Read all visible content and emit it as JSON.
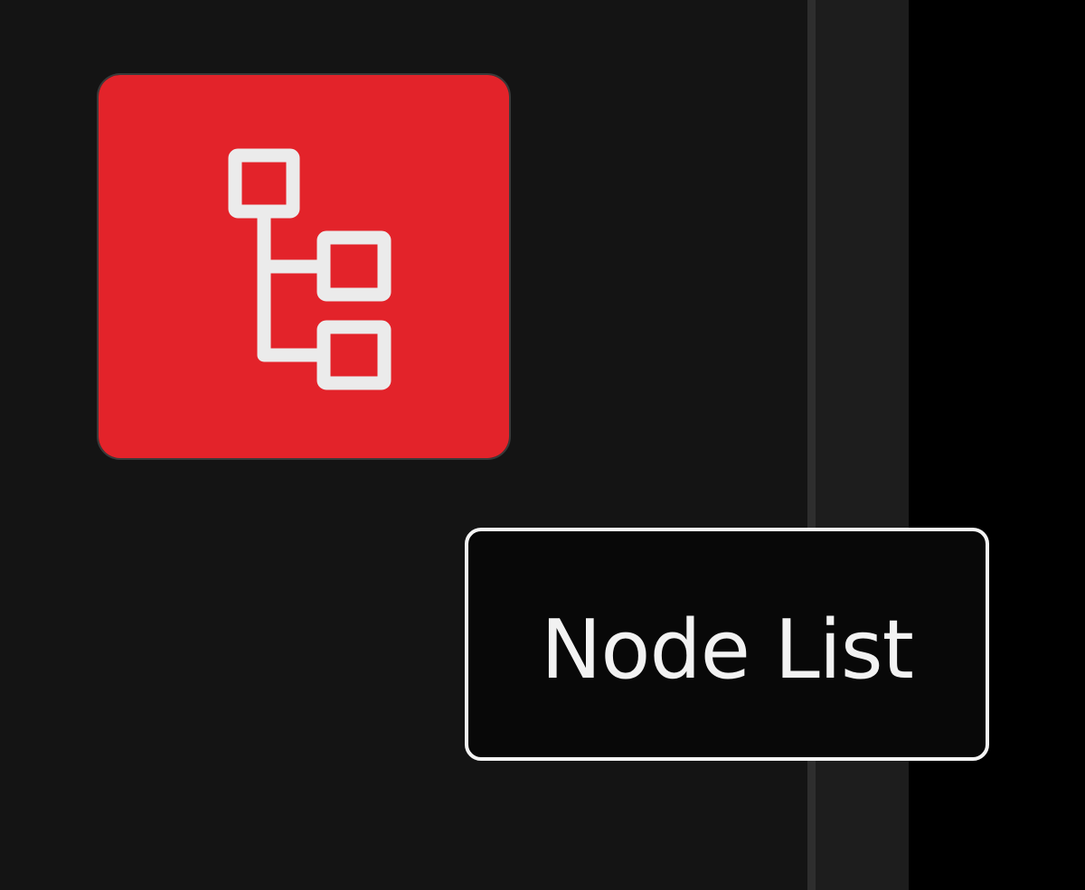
{
  "colors": {
    "button_background": "#e3232a",
    "icon_stroke": "#ebebeb",
    "tooltip_text": "#f2f2f2"
  },
  "node_list_button": {
    "icon": "hierarchy-tree-icon"
  },
  "tooltip": {
    "text": "Node List"
  }
}
